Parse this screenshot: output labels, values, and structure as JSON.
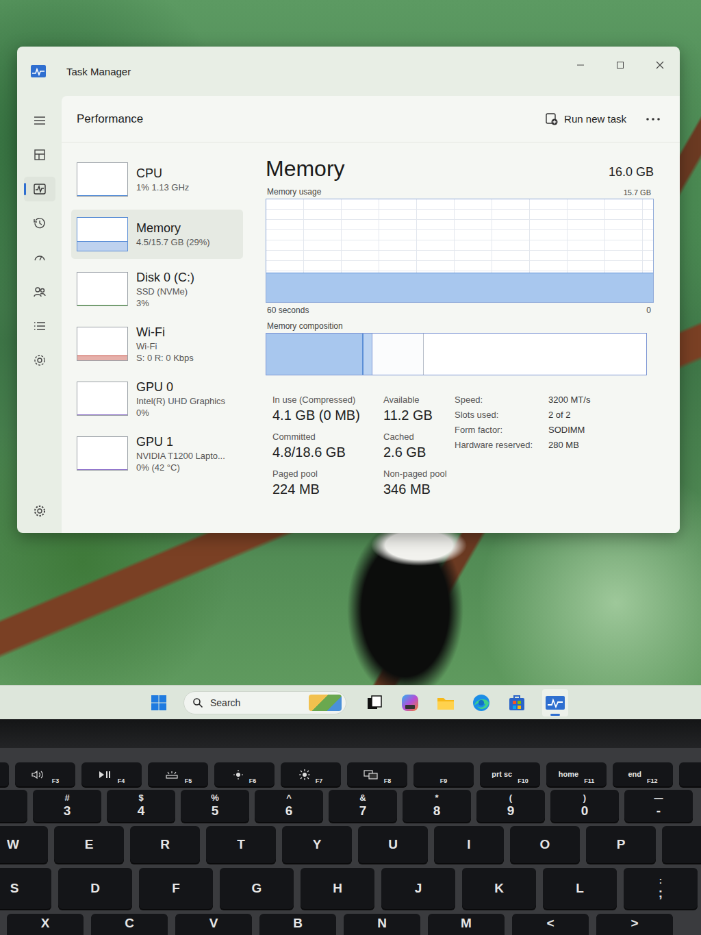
{
  "window": {
    "title": "Task Manager"
  },
  "nav_rail": {
    "items": [
      {
        "kind": "menu",
        "selected": false
      },
      {
        "kind": "processes",
        "selected": false
      },
      {
        "kind": "performance",
        "selected": true
      },
      {
        "kind": "app-history",
        "selected": false
      },
      {
        "kind": "startup",
        "selected": false
      },
      {
        "kind": "users",
        "selected": false
      },
      {
        "kind": "details",
        "selected": false
      },
      {
        "kind": "services",
        "selected": false
      }
    ]
  },
  "header": {
    "title": "Performance",
    "run_new_task": "Run new task"
  },
  "devices": [
    {
      "name": "CPU",
      "lines": [
        "1% 1.13 GHz"
      ],
      "selected": false,
      "level": 0.02,
      "color": "#4a86d4"
    },
    {
      "name": "Memory",
      "lines": [
        "4.5/15.7 GB (29%)"
      ],
      "selected": true,
      "level": 0.29,
      "color": "#5c8fd6"
    },
    {
      "name": "Disk 0 (C:)",
      "lines": [
        "SSD (NVMe)",
        "3%"
      ],
      "selected": false,
      "level": 0.03,
      "color": "#4f9a3c"
    },
    {
      "name": "Wi-Fi",
      "lines": [
        "Wi-Fi",
        "S: 0 R: 0 Kbps"
      ],
      "selected": false,
      "level": 0.15,
      "color": "#c0392b"
    },
    {
      "name": "GPU 0",
      "lines": [
        "Intel(R) UHD Graphics",
        "0%"
      ],
      "selected": false,
      "level": 0,
      "color": "#8a6cc9"
    },
    {
      "name": "GPU 1",
      "lines": [
        "NVIDIA T1200 Lapto...",
        "0% (42 °C)"
      ],
      "selected": false,
      "level": 0,
      "color": "#8a6cc9"
    }
  ],
  "memory": {
    "title": "Memory",
    "total": "16.0 GB",
    "usage_label": "Memory usage",
    "usage_max": "15.7 GB",
    "usage_level": 0.29,
    "axis_left": "60 seconds",
    "axis_right": "0",
    "composition_label": "Memory composition",
    "composition": [
      {
        "kind": "in-use",
        "level": 0.255
      },
      {
        "kind": "modified",
        "level": 0.025
      },
      {
        "kind": "standby",
        "level": 0.135
      },
      {
        "kind": "free",
        "level": 0.585
      }
    ],
    "stats": [
      {
        "label": "In use (Compressed)",
        "value": "4.1 GB (0 MB)"
      },
      {
        "label": "Available",
        "value": "11.2 GB"
      },
      {
        "label": "Committed",
        "value": "4.8/18.6 GB"
      },
      {
        "label": "Cached",
        "value": "2.6 GB"
      },
      {
        "label": "Paged pool",
        "value": "224 MB"
      },
      {
        "label": "Non-paged pool",
        "value": "346 MB"
      }
    ],
    "specs": [
      {
        "label": "Speed:",
        "value": "3200 MT/s"
      },
      {
        "label": "Slots used:",
        "value": "2 of 2"
      },
      {
        "label": "Form factor:",
        "value": "SODIMM"
      },
      {
        "label": "Hardware reserved:",
        "value": "280 MB"
      }
    ]
  },
  "taskbar": {
    "search": "Search",
    "apps": [
      {
        "kind": "task-view",
        "selected": false
      },
      {
        "kind": "m365",
        "selected": false
      },
      {
        "kind": "explorer",
        "selected": false
      },
      {
        "kind": "edge",
        "selected": false
      },
      {
        "kind": "store",
        "selected": false
      },
      {
        "kind": "task-manager",
        "selected": true
      }
    ]
  },
  "keyboard": {
    "rows": [
      {
        "kind": "fn",
        "keys": [
          {
            "kind": "blank"
          },
          {
            "kind": "volume",
            "sub": "F3"
          },
          {
            "kind": "play-pause",
            "sub": "F4"
          },
          {
            "kind": "kb-light",
            "sub": "F5"
          },
          {
            "kind": "bright-down",
            "sub": "F6"
          },
          {
            "kind": "bright-up",
            "sub": "F7"
          },
          {
            "kind": "display",
            "sub": "F8"
          },
          {
            "kind": "plain",
            "sub": "F9"
          },
          {
            "kind": "text",
            "top": "prt sc",
            "sub": "F10"
          },
          {
            "kind": "text",
            "top": "home",
            "sub": "F11"
          },
          {
            "kind": "text",
            "top": "end",
            "sub": "F12"
          },
          {
            "kind": "blank"
          }
        ]
      },
      {
        "kind": "num",
        "keys": [
          {
            "kind": "blank"
          },
          {
            "kind": "text",
            "top": "#",
            "main": "3"
          },
          {
            "kind": "text",
            "top": "$",
            "main": "4"
          },
          {
            "kind": "text",
            "top": "%",
            "main": "5"
          },
          {
            "kind": "text",
            "top": "^",
            "main": "6"
          },
          {
            "kind": "text",
            "top": "&",
            "main": "7"
          },
          {
            "kind": "text",
            "top": "*",
            "main": "8"
          },
          {
            "kind": "text",
            "top": "(",
            "main": "9"
          },
          {
            "kind": "text",
            "top": ")",
            "main": "0"
          },
          {
            "kind": "text",
            "top": "—",
            "main": "-"
          }
        ]
      },
      {
        "kind": "top",
        "keys": [
          {
            "kind": "text",
            "main": "W"
          },
          {
            "kind": "text",
            "main": "E"
          },
          {
            "kind": "text",
            "main": "R"
          },
          {
            "kind": "text",
            "main": "T"
          },
          {
            "kind": "text",
            "main": "Y"
          },
          {
            "kind": "text",
            "main": "U"
          },
          {
            "kind": "text",
            "main": "I"
          },
          {
            "kind": "text",
            "main": "O"
          },
          {
            "kind": "text",
            "main": "P"
          },
          {
            "kind": "blank"
          }
        ]
      },
      {
        "kind": "home",
        "keys": [
          {
            "kind": "text",
            "main": "S"
          },
          {
            "kind": "text",
            "main": "D"
          },
          {
            "kind": "text",
            "main": "F"
          },
          {
            "kind": "text",
            "main": "G"
          },
          {
            "kind": "text",
            "main": "H"
          },
          {
            "kind": "text",
            "main": "J"
          },
          {
            "kind": "text",
            "main": "K"
          },
          {
            "kind": "text",
            "main": "L"
          },
          {
            "kind": "text",
            "top": ":",
            "main": ";"
          }
        ]
      },
      {
        "kind": "bottom",
        "keys": [
          {
            "kind": "blank"
          },
          {
            "kind": "text",
            "main": "X"
          },
          {
            "kind": "text",
            "main": "C"
          },
          {
            "kind": "text",
            "main": "V"
          },
          {
            "kind": "text",
            "main": "B"
          },
          {
            "kind": "text",
            "main": "N"
          },
          {
            "kind": "text",
            "main": "M"
          },
          {
            "kind": "text",
            "main": "<"
          },
          {
            "kind": "text",
            "main": ">"
          }
        ]
      }
    ]
  }
}
